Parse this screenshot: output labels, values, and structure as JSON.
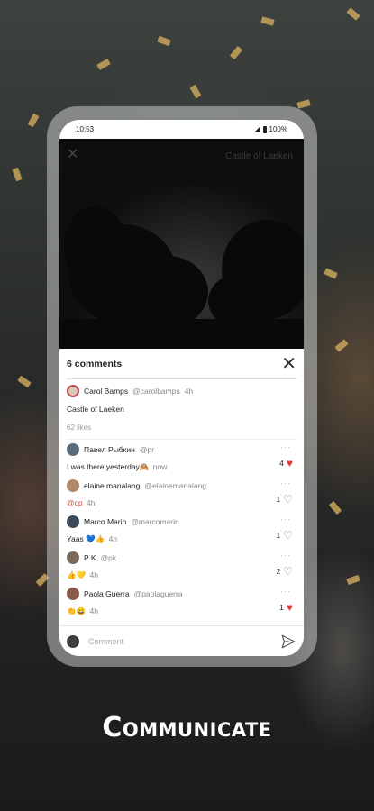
{
  "status_bar": {
    "time": "10:53",
    "battery": "100%"
  },
  "video": {
    "title": "Castle of Laeken"
  },
  "comments_panel": {
    "title": "6 comments",
    "post": {
      "author": "Carol Bamps",
      "handle": "@carolbamps",
      "time": "4h",
      "text": "Castle of Laeken",
      "likes": "62 likes"
    },
    "comments": [
      {
        "author": "Павел Рыбкин",
        "handle": "@pr",
        "text": "I was there yesterday🙈",
        "mention": "",
        "time": "now",
        "likes": "4",
        "liked": true,
        "avatar_color": "#5a6b7c"
      },
      {
        "author": "elaine manalang",
        "handle": "@elainemanalang",
        "text": "",
        "mention": "@cp",
        "time": "4h",
        "likes": "1",
        "liked": false,
        "avatar_color": "#b08a6a"
      },
      {
        "author": "Marco Marin",
        "handle": "@marcomarin",
        "text": "Yaas 💙👍",
        "mention": "",
        "time": "4h",
        "likes": "1",
        "liked": false,
        "avatar_color": "#3d4a5a"
      },
      {
        "author": "P K",
        "handle": "@pk",
        "text": "👍💛",
        "mention": "",
        "time": "4h",
        "likes": "2",
        "liked": false,
        "avatar_color": "#7a6a5a"
      },
      {
        "author": "Paola Guerra",
        "handle": "@paolaguerra",
        "text": "👏😀",
        "mention": "",
        "time": "4h",
        "likes": "1",
        "liked": true,
        "avatar_color": "#8a5a4a"
      }
    ],
    "compose_placeholder": "Comment"
  },
  "caption": "Communicate",
  "colors": {
    "accent": "#e53935",
    "mention": "#e0443a"
  }
}
